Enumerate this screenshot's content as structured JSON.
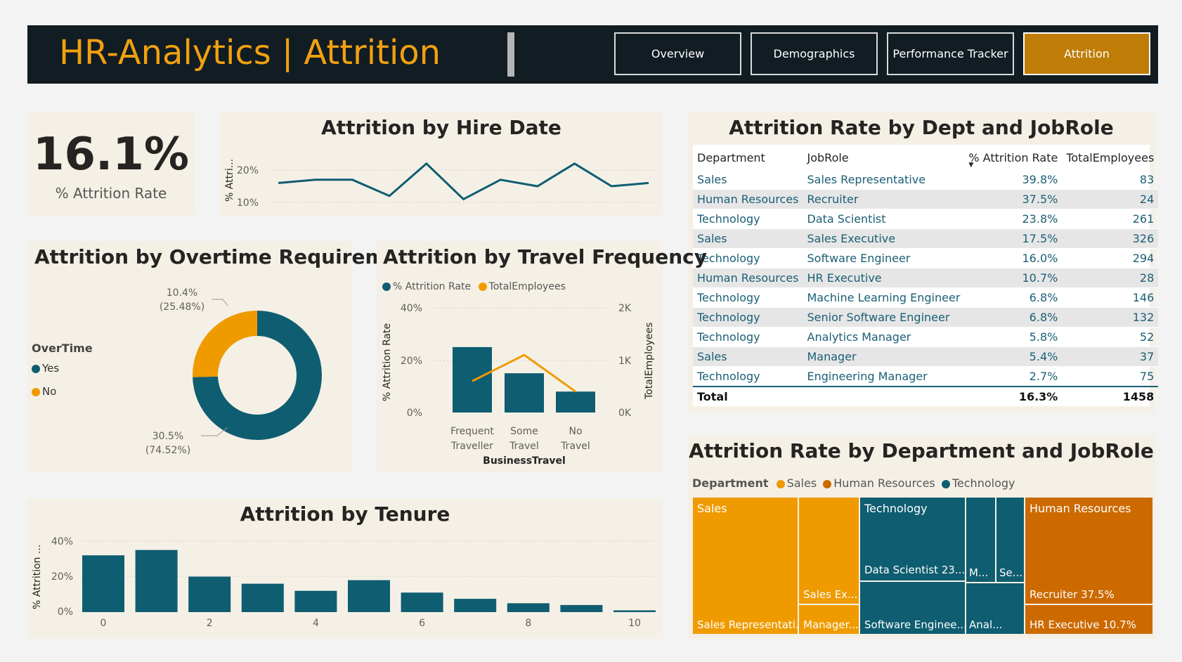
{
  "header": {
    "title": "HR-Analytics | Attrition",
    "nav": [
      {
        "label": "Overview",
        "active": false
      },
      {
        "label": "Demographics",
        "active": false
      },
      {
        "label": "Performance Tracker",
        "active": false
      },
      {
        "label": "Attrition",
        "active": true
      }
    ]
  },
  "kpi": {
    "value": "16.1%",
    "label": "% Attrition Rate"
  },
  "colors": {
    "teal": "#0f5d71",
    "orange": "#ef9b00",
    "dark_orange": "#cc6a00",
    "accent": "#bf7d07"
  },
  "hire_date": {
    "title": "Attrition by Hire Date",
    "ylabel": "% Attri...",
    "yticks": [
      "20%",
      "10%"
    ],
    "chart_data": {
      "type": "line",
      "values": [
        16,
        17,
        17,
        12,
        22,
        11,
        17,
        15,
        22,
        15,
        16
      ],
      "ylim": [
        5,
        25
      ]
    }
  },
  "overtime": {
    "title": "Attrition by Overtime Requirement",
    "legend_title": "OverTime",
    "legend": [
      "Yes",
      "No"
    ],
    "chart_data": {
      "type": "pie",
      "slices": [
        {
          "name": "Yes",
          "rate": "30.5%",
          "share": 74.52,
          "label1": "30.5%",
          "label2": "(74.52%)"
        },
        {
          "name": "No",
          "rate": "10.4%",
          "share": 25.48,
          "label1": "10.4%",
          "label2": "(25.48%)"
        }
      ]
    }
  },
  "travel": {
    "title": "Attrition by Travel Frequency",
    "legend": [
      "% Attrition Rate",
      "TotalEmployees"
    ],
    "ylabel_left": "% Attrition Rate",
    "ylabel_right": "TotalEmployees",
    "xlabel": "BusinessTravel",
    "yticks_left": [
      "40%",
      "20%",
      "0%"
    ],
    "yticks_right": [
      "2K",
      "1K",
      "0K"
    ],
    "categories": [
      [
        "Frequent",
        "Traveller"
      ],
      [
        "Some",
        "Travel"
      ],
      [
        "No",
        "Travel"
      ]
    ],
    "chart_data": {
      "type": "bar",
      "series": [
        {
          "name": "% Attrition Rate",
          "values": [
            25,
            15,
            8
          ]
        },
        {
          "name": "TotalEmployees",
          "values": [
            600,
            1100,
            400
          ]
        }
      ],
      "ylim_left": [
        0,
        40
      ],
      "ylim_right": [
        0,
        2000
      ]
    }
  },
  "tenure": {
    "title": "Attrition by Tenure",
    "ylabel": "% Attrition ...",
    "yticks": [
      "40%",
      "20%",
      "0%"
    ],
    "xticks": [
      "0",
      "2",
      "4",
      "6",
      "8",
      "10"
    ],
    "chart_data": {
      "type": "bar",
      "x": [
        0,
        1,
        2,
        3,
        4,
        5,
        6,
        7,
        8,
        9,
        10
      ],
      "values": [
        32,
        35,
        20,
        16,
        12,
        18,
        11,
        7.5,
        5,
        4,
        1
      ],
      "ylim": [
        0,
        40
      ]
    }
  },
  "dept_table": {
    "title": "Attrition Rate by Dept and JobRole",
    "columns": [
      "Department",
      "JobRole",
      "% Attrition Rate",
      "TotalEmployees"
    ],
    "rows": [
      [
        "Sales",
        "Sales Representative",
        "39.8%",
        "83"
      ],
      [
        "Human Resources",
        "Recruiter",
        "37.5%",
        "24"
      ],
      [
        "Technology",
        "Data Scientist",
        "23.8%",
        "261"
      ],
      [
        "Sales",
        "Sales Executive",
        "17.5%",
        "326"
      ],
      [
        "Technology",
        "Software Engineer",
        "16.0%",
        "294"
      ],
      [
        "Human Resources",
        "HR Executive",
        "10.7%",
        "28"
      ],
      [
        "Technology",
        "Machine Learning Engineer",
        "6.8%",
        "146"
      ],
      [
        "Technology",
        "Senior Software Engineer",
        "6.8%",
        "132"
      ],
      [
        "Technology",
        "Analytics Manager",
        "5.8%",
        "52"
      ],
      [
        "Sales",
        "Manager",
        "5.4%",
        "37"
      ],
      [
        "Technology",
        "Engineering Manager",
        "2.7%",
        "75"
      ]
    ],
    "total": [
      "Total",
      "",
      "16.3%",
      "1458"
    ]
  },
  "treemap": {
    "title": "Attrition Rate by Department and JobRole",
    "legend_title": "Department",
    "legend": [
      "Sales",
      "Human Resources",
      "Technology"
    ],
    "groups": {
      "sales": "Sales",
      "tech": "Technology",
      "hr": "Human Resources"
    },
    "labels": {
      "sales_rep": "Sales Representati...",
      "sales_ex": "Sales Ex...",
      "manager": "Manager...",
      "data_sci": "Data Scientist 23....",
      "soft_eng": "Software Enginee...",
      "m": "M...",
      "se": "Se...",
      "anal": "Anal...",
      "recruiter": "Recruiter 37.5%",
      "hr_exec": "HR Executive 10.7%"
    }
  }
}
